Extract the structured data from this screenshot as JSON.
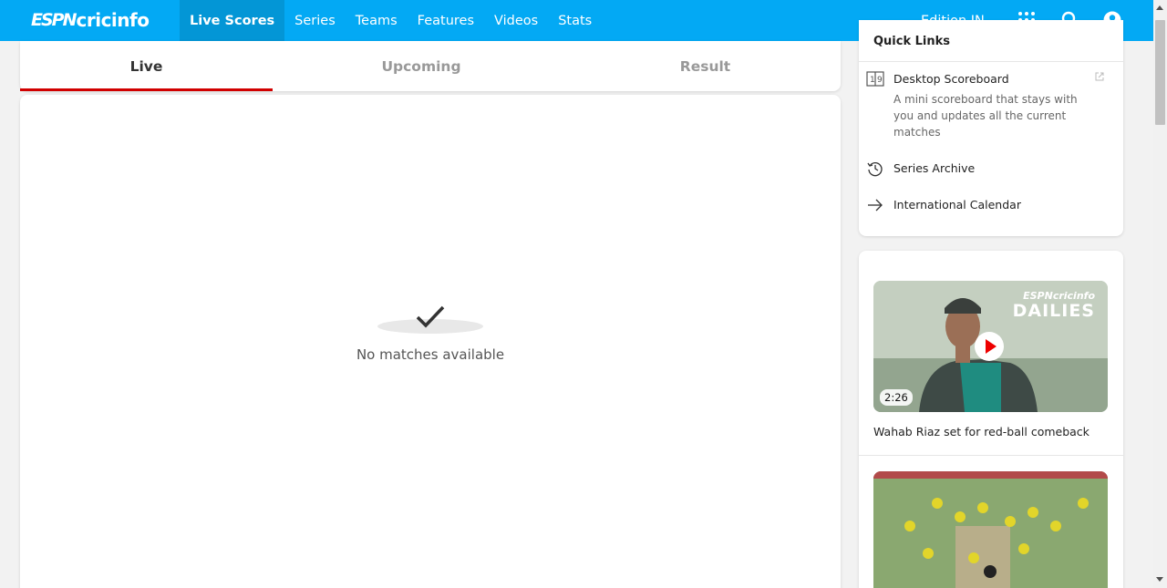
{
  "brand": {
    "espn": "ESPN",
    "cricinfo": "cricinfo"
  },
  "nav": {
    "items": [
      {
        "label": "Live Scores",
        "active": true
      },
      {
        "label": "Series"
      },
      {
        "label": "Teams"
      },
      {
        "label": "Features"
      },
      {
        "label": "Videos"
      },
      {
        "label": "Stats"
      }
    ],
    "edition": "Edition IN",
    "icons": [
      "apps-grid-icon",
      "search-icon",
      "user-icon"
    ],
    "colors": {
      "bar": "#03a9f4",
      "active": "#0396d6"
    }
  },
  "tabs": [
    {
      "label": "Live",
      "active": true
    },
    {
      "label": "Upcoming"
    },
    {
      "label": "Result"
    }
  ],
  "tab_active_color": "#d10000",
  "empty_state": {
    "message": "No matches available",
    "icon": "checkmark-icon"
  },
  "quick_links": {
    "title": "Quick Links",
    "items": [
      {
        "label": "Desktop Scoreboard",
        "description": "A mini scoreboard that stays with you and updates all the current matches",
        "icon": "scoreboard-icon",
        "external": true
      },
      {
        "label": "Series Archive",
        "icon": "history-icon"
      },
      {
        "label": "International Calendar",
        "icon": "arrow-right-icon"
      }
    ]
  },
  "videos": [
    {
      "title": "Wahab Riaz set for red-ball comeback",
      "duration": "2:26",
      "overlay": {
        "brand": "ESPNcricinfo",
        "show": "DAILIES"
      }
    },
    {
      "title": ""
    }
  ]
}
